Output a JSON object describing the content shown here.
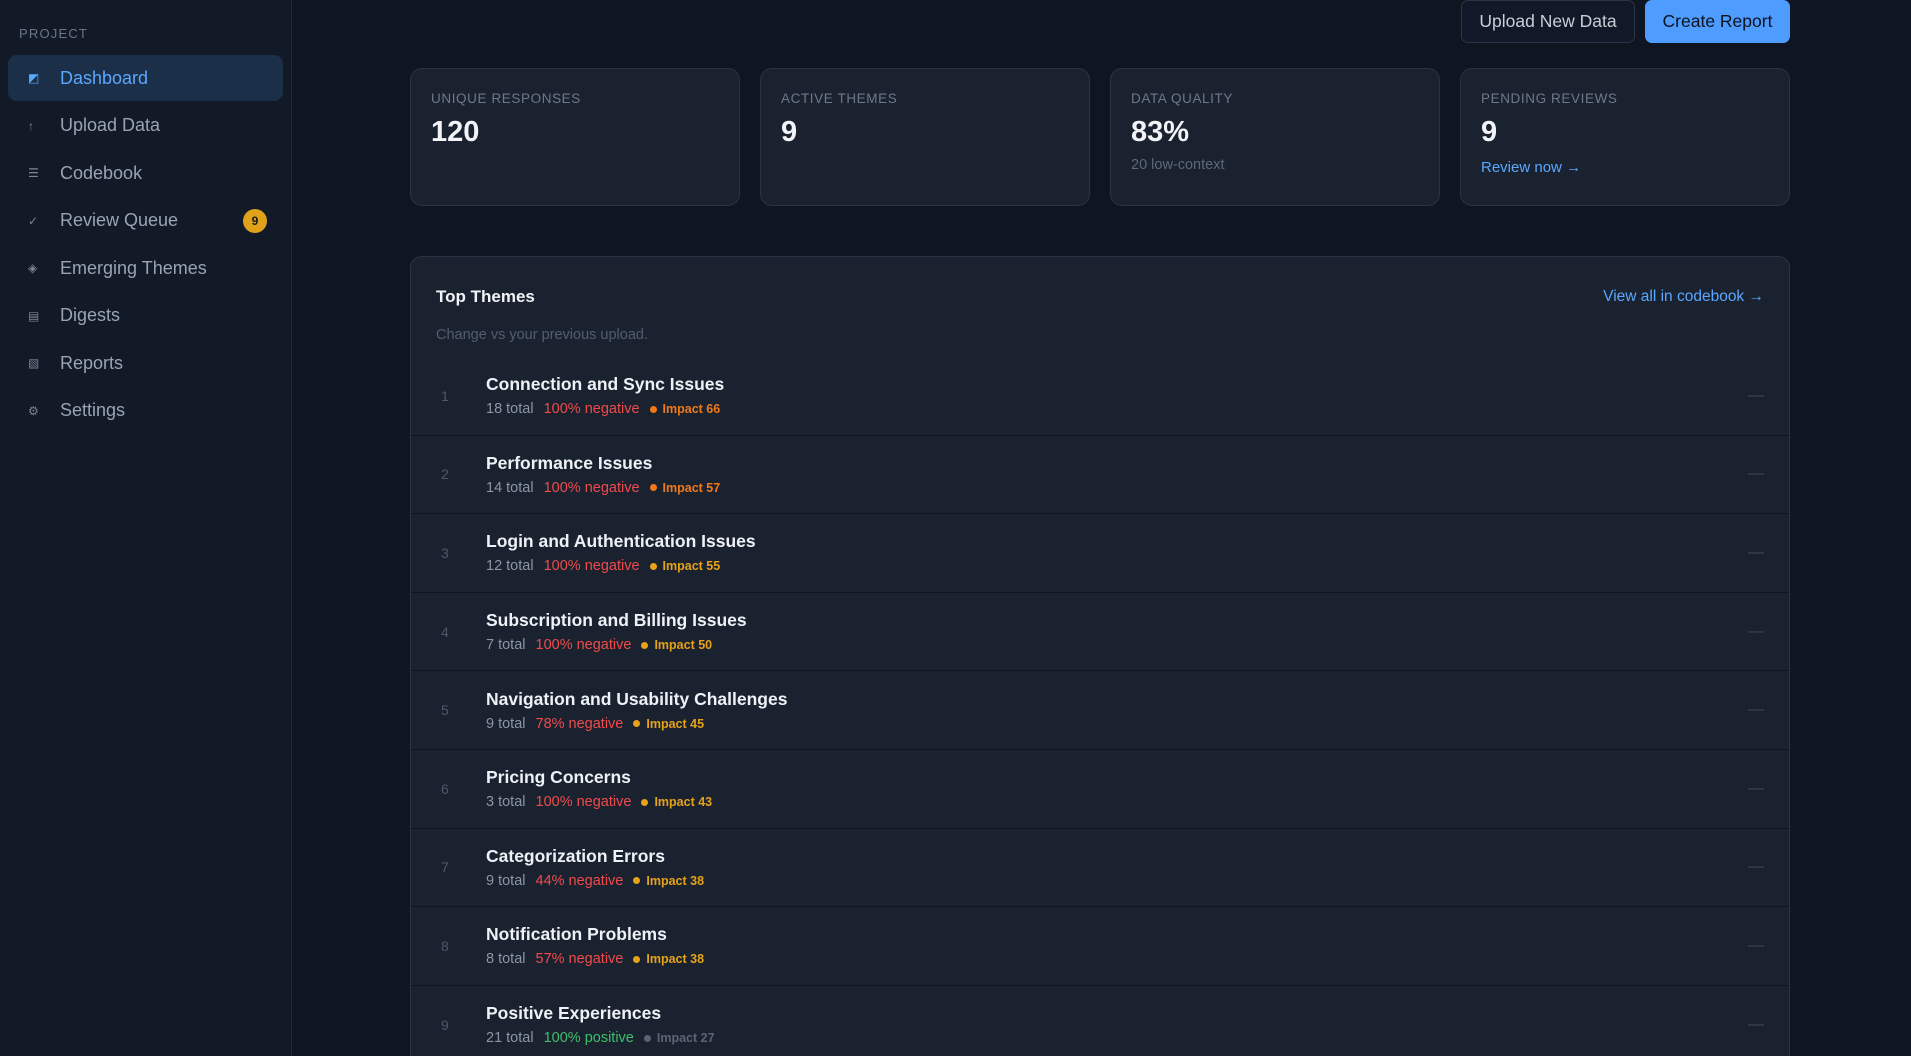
{
  "sidebar": {
    "section_label": "PROJECT",
    "items": [
      {
        "label": "Dashboard",
        "icon": "dashboard-icon",
        "glyph": "◩",
        "active": true
      },
      {
        "label": "Upload Data",
        "icon": "upload-icon",
        "glyph": "↑"
      },
      {
        "label": "Codebook",
        "icon": "list-icon",
        "glyph": "☰"
      },
      {
        "label": "Review Queue",
        "icon": "check-icon",
        "glyph": "✓",
        "badge": "9"
      },
      {
        "label": "Emerging Themes",
        "icon": "diamond-icon",
        "glyph": "◈"
      },
      {
        "label": "Digests",
        "icon": "digest-icon",
        "glyph": "▤"
      },
      {
        "label": "Reports",
        "icon": "report-icon",
        "glyph": "▧"
      },
      {
        "label": "Settings",
        "icon": "gear-icon",
        "glyph": "⚙"
      }
    ]
  },
  "toolbar": {
    "upload_label": "Upload New Data",
    "create_label": "Create Report"
  },
  "stats": {
    "unique_responses": {
      "label": "UNIQUE RESPONSES",
      "value": "120"
    },
    "active_themes": {
      "label": "ACTIVE THEMES",
      "value": "9"
    },
    "data_quality": {
      "label": "DATA QUALITY",
      "value": "83%",
      "sub": "20 low-context"
    },
    "pending_reviews": {
      "label": "PENDING REVIEWS",
      "value": "9",
      "link": "Review now →"
    }
  },
  "themes": {
    "title": "Top Themes",
    "view_all": "View all in codebook →",
    "subtitle": "Change vs your previous upload.",
    "rows": [
      {
        "rank": "1",
        "name": "Connection and Sync Issues",
        "total": "18 total",
        "sentiment": "100% negative",
        "polarity": "negative",
        "impact": "Impact 66",
        "impact_color": "#f07a1a",
        "trend": "—"
      },
      {
        "rank": "2",
        "name": "Performance Issues",
        "total": "14 total",
        "sentiment": "100% negative",
        "polarity": "negative",
        "impact": "Impact 57",
        "impact_color": "#f07a1a",
        "trend": "—"
      },
      {
        "rank": "3",
        "name": "Login and Authentication Issues",
        "total": "12 total",
        "sentiment": "100% negative",
        "polarity": "negative",
        "impact": "Impact 55",
        "impact_color": "#e6a219",
        "trend": "—"
      },
      {
        "rank": "4",
        "name": "Subscription and Billing Issues",
        "total": "7 total",
        "sentiment": "100% negative",
        "polarity": "negative",
        "impact": "Impact 50",
        "impact_color": "#e6a219",
        "trend": "—"
      },
      {
        "rank": "5",
        "name": "Navigation and Usability Challenges",
        "total": "9 total",
        "sentiment": "78% negative",
        "polarity": "negative",
        "impact": "Impact 45",
        "impact_color": "#e6a219",
        "trend": "—"
      },
      {
        "rank": "6",
        "name": "Pricing Concerns",
        "total": "3 total",
        "sentiment": "100% negative",
        "polarity": "negative",
        "impact": "Impact 43",
        "impact_color": "#e6a219",
        "trend": "—"
      },
      {
        "rank": "7",
        "name": "Categorization Errors",
        "total": "9 total",
        "sentiment": "44% negative",
        "polarity": "negative",
        "impact": "Impact 38",
        "impact_color": "#e6a219",
        "trend": "—"
      },
      {
        "rank": "8",
        "name": "Notification Problems",
        "total": "8 total",
        "sentiment": "57% negative",
        "polarity": "negative",
        "impact": "Impact 38",
        "impact_color": "#e6a219",
        "trend": "—"
      },
      {
        "rank": "9",
        "name": "Positive Experiences",
        "total": "21 total",
        "sentiment": "100% positive",
        "polarity": "positive",
        "impact": "Impact 27",
        "impact_color": "#5c6474",
        "trend": "—"
      }
    ]
  }
}
